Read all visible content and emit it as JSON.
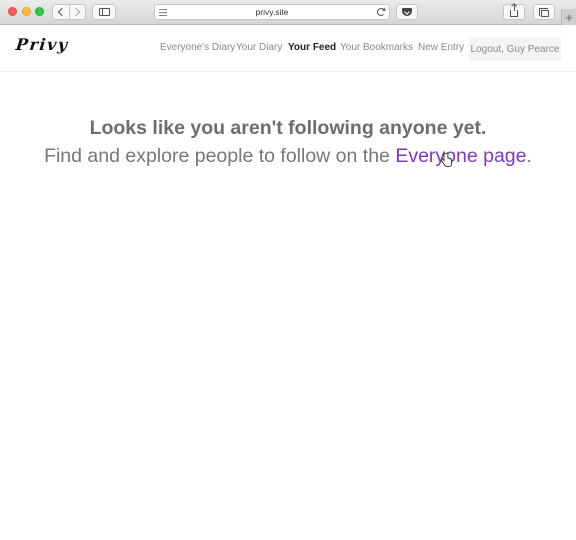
{
  "browser": {
    "url": "privy.site",
    "buttons": {
      "back": "chevron-left-icon",
      "forward": "chevron-right-icon",
      "sidebar": "sidebar-icon",
      "reload": "reload-icon",
      "pocket": "pocket-icon",
      "share": "share-icon",
      "tabs": "tabs-icon",
      "new_tab": "+"
    }
  },
  "site": {
    "logo": "Privy",
    "nav": [
      {
        "label": "Everyone's Diary",
        "active": false
      },
      {
        "label": "Your Diary",
        "active": false
      },
      {
        "label": "Your Feed",
        "active": true
      },
      {
        "label": "Your Bookmarks",
        "active": false
      },
      {
        "label": "New Entry",
        "active": false
      }
    ],
    "logout_label": "Logout, Guy Pearce"
  },
  "message": {
    "headline": "Looks like you aren't following anyone yet.",
    "sub_prefix": "Find and explore people to follow on the ",
    "link_text": "Everyone page",
    "sub_suffix": "."
  },
  "colors": {
    "link": "#7e3ab2",
    "text_muted": "#777777",
    "nav_active": "#222222"
  }
}
